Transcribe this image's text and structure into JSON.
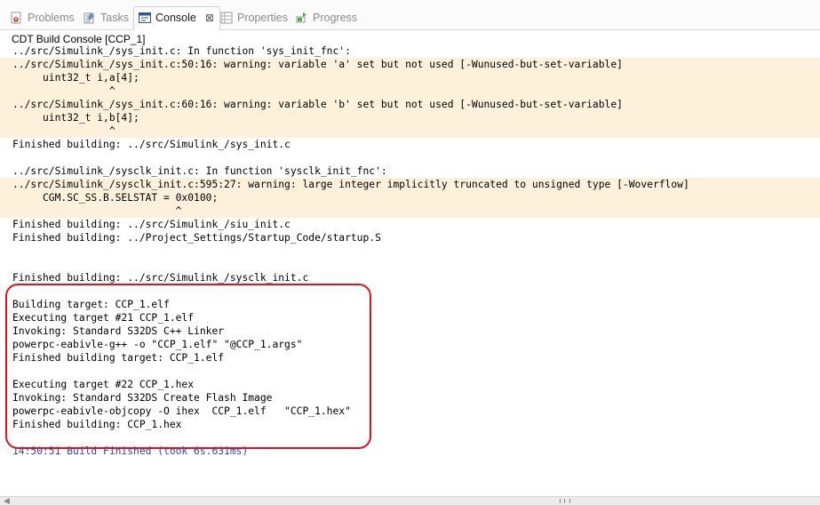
{
  "tabs": [
    {
      "label": "Problems",
      "icon": "problems-icon"
    },
    {
      "label": "Tasks",
      "icon": "tasks-icon"
    },
    {
      "label": "Console",
      "icon": "console-icon",
      "active": true
    },
    {
      "label": "Properties",
      "icon": "properties-icon"
    },
    {
      "label": "Progress",
      "icon": "progress-icon"
    }
  ],
  "close_glyph": "⊠",
  "console_title": "CDT Build Console [CCP_1]",
  "console_lines": [
    "../src/Simulink_/sys_init.c: In function 'sys_init_fnc':",
    "../src/Simulink_/sys_init.c:50:16: warning: variable 'a' set but not used [-Wunused-but-set-variable]",
    "     uint32_t i,a[4];",
    "                ^",
    "../src/Simulink_/sys_init.c:60:16: warning: variable 'b' set but not used [-Wunused-but-set-variable]",
    "     uint32_t i,b[4];",
    "                ^",
    "Finished building: ../src/Simulink_/sys_init.c",
    "",
    "../src/Simulink_/sysclk_init.c: In function 'sysclk_init_fnc':",
    "../src/Simulink_/sysclk_init.c:595:27: warning: large integer implicitly truncated to unsigned type [-Woverflow]",
    "     CGM.SC_SS.B.SELSTAT = 0x0100;",
    "                           ^",
    "Finished building: ../src/Simulink_/siu_init.c",
    "Finished building: ../Project_Settings/Startup_Code/startup.S",
    "",
    "",
    "Finished building: ../src/Simulink_/sysclk_init.c",
    "",
    "Building target: CCP_1.elf",
    "Executing target #21 CCP_1.elf",
    "Invoking: Standard S32DS C++ Linker",
    "powerpc-eabivle-g++ -o \"CCP_1.elf\" \"@CCP_1.args\"",
    "Finished building target: CCP_1.elf",
    "",
    "Executing target #22 CCP_1.hex",
    "Invoking: Standard S32DS Create Flash Image",
    "powerpc-eabivle-objcopy -O ihex  CCP_1.elf   \"CCP_1.hex\"",
    "Finished building: CCP_1.hex",
    "",
    "14:50:51 Build Finished (took 6s.631ms)"
  ],
  "warning_line_indices": [
    1,
    2,
    3,
    4,
    5,
    6,
    10,
    11,
    12
  ],
  "status_line_index": 30,
  "colors": {
    "warning_bg": "#fdf1dc",
    "status_text": "#1f4bb8",
    "highlight_border": "#e0121d"
  }
}
